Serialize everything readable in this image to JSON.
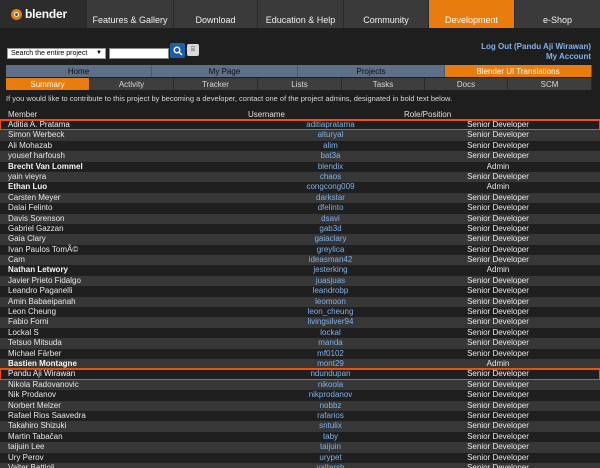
{
  "header": {
    "logo_text": "blender",
    "nav": [
      {
        "label": "Features & Gallery",
        "active": false
      },
      {
        "label": "Download",
        "active": false
      },
      {
        "label": "Education & Help",
        "active": false
      },
      {
        "label": "Community",
        "active": false
      },
      {
        "label": "Development",
        "active": true
      },
      {
        "label": "e-Shop",
        "active": false
      }
    ]
  },
  "search": {
    "scope": "Search the entire project",
    "query": ""
  },
  "account": {
    "logout": "Log Out (Pandu Aji Wirawan)",
    "my_account": "My Account"
  },
  "project_tabs": [
    {
      "label": "Home",
      "active": false
    },
    {
      "label": "My Page",
      "active": false
    },
    {
      "label": "Projects",
      "active": false
    },
    {
      "label": "Blender UI Translations",
      "active": true
    }
  ],
  "sub_tabs": [
    {
      "label": "Summary",
      "active": true
    },
    {
      "label": "Activity",
      "active": false
    },
    {
      "label": "Tracker",
      "active": false
    },
    {
      "label": "Lists",
      "active": false
    },
    {
      "label": "Tasks",
      "active": false
    },
    {
      "label": "Docs",
      "active": false
    },
    {
      "label": "SCM",
      "active": false
    }
  ],
  "intro": "If you would like to contribute to this project by becoming a developer, contact one of the project admins, designated in bold text below.",
  "table": {
    "columns": [
      "Member",
      "Username",
      "Role/Position"
    ],
    "rows": [
      {
        "member": "Aditia A. Pratama",
        "username": "aditiapratama",
        "role": "Senior Developer",
        "admin": false,
        "highlight": true
      },
      {
        "member": "Simon Werbeck",
        "username": "alturyal",
        "role": "Senior Developer",
        "admin": false,
        "highlight": false
      },
      {
        "member": "Ali Mohazab",
        "username": "alim",
        "role": "Senior Developer",
        "admin": false,
        "highlight": false
      },
      {
        "member": "yousef harfoush",
        "username": "bat3a",
        "role": "Senior Developer",
        "admin": false,
        "highlight": false
      },
      {
        "member": "Brecht Van Lommel",
        "username": "blendix",
        "role": "Admin",
        "admin": true,
        "highlight": false
      },
      {
        "member": "yain vieyra",
        "username": "chaos",
        "role": "Senior Developer",
        "admin": false,
        "highlight": false
      },
      {
        "member": "Ethan Luo",
        "username": "congcong009",
        "role": "Admin",
        "admin": true,
        "highlight": false
      },
      {
        "member": "Carsten Meyer",
        "username": "darkstar",
        "role": "Senior Developer",
        "admin": false,
        "highlight": false
      },
      {
        "member": "Dalai Felinto",
        "username": "dfelinto",
        "role": "Senior Developer",
        "admin": false,
        "highlight": false
      },
      {
        "member": "Davis Sorenson",
        "username": "dsavi",
        "role": "Senior Developer",
        "admin": false,
        "highlight": false
      },
      {
        "member": "Gabriel Gazzan",
        "username": "gab3d",
        "role": "Senior Developer",
        "admin": false,
        "highlight": false
      },
      {
        "member": "Gaia Clary",
        "username": "gaiaclary",
        "role": "Senior Developer",
        "admin": false,
        "highlight": false
      },
      {
        "member": "Ivan Paulos TomÃ©",
        "username": "greylica",
        "role": "Senior Developer",
        "admin": false,
        "highlight": false
      },
      {
        "member": "Cam",
        "username": "ideasman42",
        "role": "Senior Developer",
        "admin": false,
        "highlight": false
      },
      {
        "member": "Nathan Letwory",
        "username": "jesterking",
        "role": "Admin",
        "admin": true,
        "highlight": false
      },
      {
        "member": "Javier Prieto Fidalgo",
        "username": "juasjuas",
        "role": "Senior Developer",
        "admin": false,
        "highlight": false
      },
      {
        "member": "Leandro Paganelli",
        "username": "leandrobp",
        "role": "Senior Developer",
        "admin": false,
        "highlight": false
      },
      {
        "member": "Amin Babaeipanah",
        "username": "leomoon",
        "role": "Senior Developer",
        "admin": false,
        "highlight": false
      },
      {
        "member": "Leon Cheung",
        "username": "leon_cheung",
        "role": "Senior Developer",
        "admin": false,
        "highlight": false
      },
      {
        "member": "Fabio Forni",
        "username": "livingsilver94",
        "role": "Senior Developer",
        "admin": false,
        "highlight": false
      },
      {
        "member": "Lockal S",
        "username": "lockal",
        "role": "Senior Developer",
        "admin": false,
        "highlight": false
      },
      {
        "member": "Tetsuo Mitsuda",
        "username": "manda",
        "role": "Senior Developer",
        "admin": false,
        "highlight": false
      },
      {
        "member": "Michael Färber",
        "username": "mf0102",
        "role": "Senior Developer",
        "admin": false,
        "highlight": false
      },
      {
        "member": "Bastien Montagne",
        "username": "mont29",
        "role": "Admin",
        "admin": true,
        "highlight": false
      },
      {
        "member": "Pandu Aji Wirawan",
        "username": "ndundupan",
        "role": "Senior Developer",
        "admin": false,
        "highlight": true
      },
      {
        "member": "Nikola Radovanovic",
        "username": "nikoola",
        "role": "Senior Developer",
        "admin": false,
        "highlight": false
      },
      {
        "member": "Nik Prodanov",
        "username": "nikprodanov",
        "role": "Senior Developer",
        "admin": false,
        "highlight": false
      },
      {
        "member": "Norbert Melzer",
        "username": "nobbz",
        "role": "Senior Developer",
        "admin": false,
        "highlight": false
      },
      {
        "member": "Rafael Rios Saavedra",
        "username": "rafarios",
        "role": "Senior Developer",
        "admin": false,
        "highlight": false
      },
      {
        "member": "Takahiro Shizuki",
        "username": "sntulix",
        "role": "Senior Developer",
        "admin": false,
        "highlight": false
      },
      {
        "member": "Martin Tabačan",
        "username": "taby",
        "role": "Senior Developer",
        "admin": false,
        "highlight": false
      },
      {
        "member": "taijuin Lee",
        "username": "taijuin",
        "role": "Senior Developer",
        "admin": false,
        "highlight": false
      },
      {
        "member": "Ury Perov",
        "username": "urypet",
        "role": "Senior Developer",
        "admin": false,
        "highlight": false
      },
      {
        "member": "Valter Battioli",
        "username": "valtersb",
        "role": "Senior Developer",
        "admin": false,
        "highlight": false
      }
    ]
  },
  "colors": {
    "accent": "#e87d0d",
    "highlight_border": "#e8521a",
    "link": "#7fb2ea",
    "tab_blue": "#5d7087"
  }
}
